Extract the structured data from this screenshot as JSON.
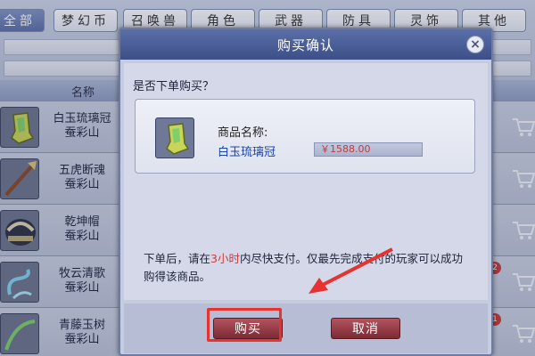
{
  "tabs": [
    {
      "label": "全部",
      "active": true
    },
    {
      "label": "梦幻币",
      "active": false
    },
    {
      "label": "召唤兽",
      "active": false
    },
    {
      "label": "角色",
      "active": false
    },
    {
      "label": "武器",
      "active": false
    },
    {
      "label": "防具",
      "active": false
    },
    {
      "label": "灵饰",
      "active": false
    },
    {
      "label": "其他",
      "active": false
    }
  ],
  "list": {
    "header_name": "名称",
    "items": [
      {
        "name": "白玉琉璃冠",
        "server": "蚕彩山"
      },
      {
        "name": "五虎断魂",
        "server": "蚕彩山"
      },
      {
        "name": "乾坤帽",
        "server": "蚕彩山"
      },
      {
        "name": "牧云清歌",
        "server": "蚕彩山"
      },
      {
        "name": "青藤玉树",
        "server": "蚕彩山"
      }
    ],
    "badges": [
      "2",
      "1"
    ]
  },
  "dialog": {
    "title": "购买确认",
    "question": "是否下单购买？",
    "product_label": "商品名称:",
    "product_name": "白玉琉璃冠",
    "price": "￥1588.00",
    "notice_before": "下单后，请在",
    "notice_highlight": "3小时",
    "notice_after": "内尽快支付。仅最先完成支付的玩家可以成功购得该商品。",
    "buy_label": "购买",
    "cancel_label": "取消"
  },
  "colors": {
    "title_bar": "#4a5e98",
    "button": "#9a3a45",
    "highlight": "#e8322f",
    "price_text": "#c23b3b"
  }
}
